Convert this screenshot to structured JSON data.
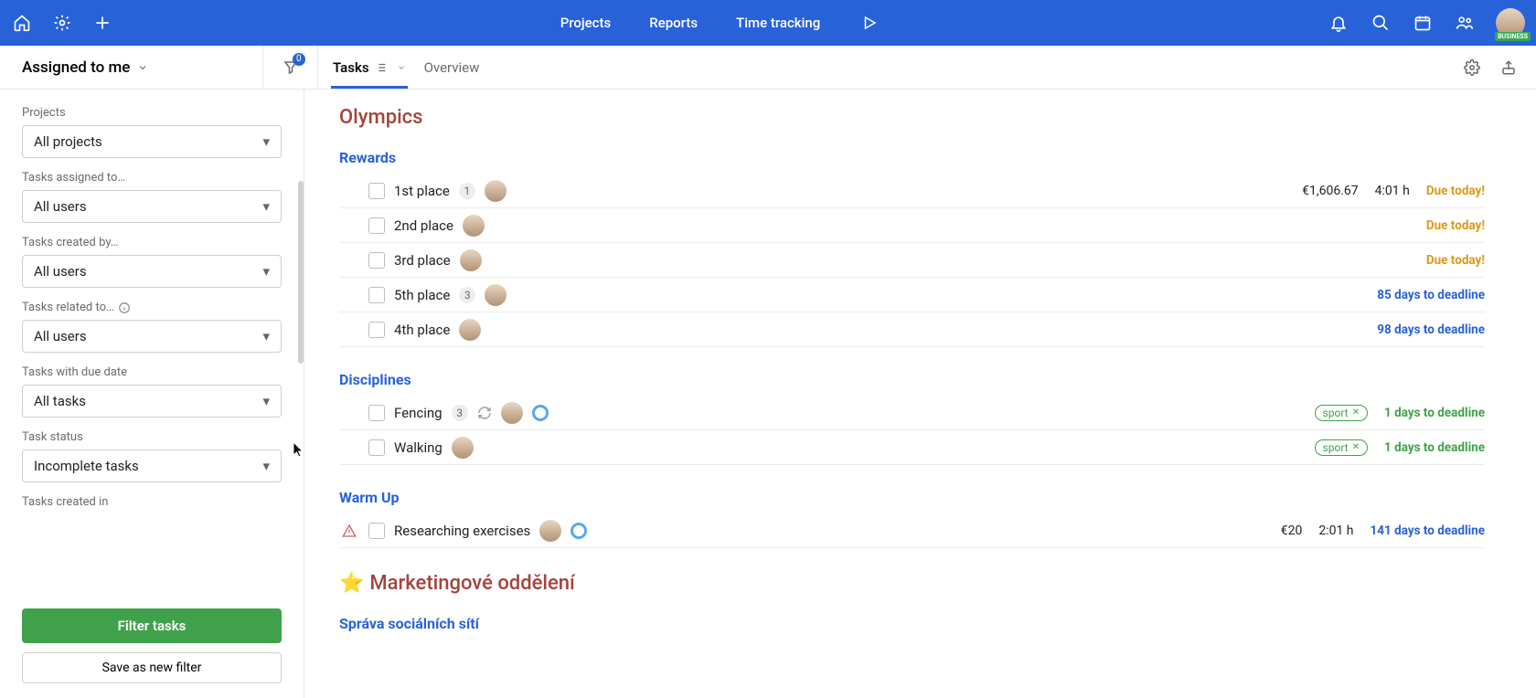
{
  "topnav": {
    "projects": "Projects",
    "reports": "Reports",
    "time_tracking": "Time tracking"
  },
  "avatar_badge": "BUSINESS",
  "sidebar_header": "Assigned to me",
  "filter_count": "0",
  "tabs": {
    "tasks": "Tasks",
    "overview": "Overview"
  },
  "filters": {
    "projects_label": "Projects",
    "projects_value": "All projects",
    "assigned_label": "Tasks assigned to…",
    "assigned_value": "All users",
    "created_by_label": "Tasks created by…",
    "created_by_value": "All users",
    "related_label": "Tasks related to…",
    "related_value": "All users",
    "due_label": "Tasks with due date",
    "due_value": "All tasks",
    "status_label": "Task status",
    "status_value": "Incomplete tasks",
    "created_in_label": "Tasks created in",
    "filter_btn": "Filter tasks",
    "save_btn": "Save as new filter"
  },
  "project1": {
    "title": "Olympics",
    "rewards_heading": "Rewards",
    "rewards": [
      {
        "name": "1st place",
        "badge": "1",
        "money": "€1,606.67",
        "hours": "4:01 h",
        "due": "Due today!",
        "due_type": "today"
      },
      {
        "name": "2nd place",
        "badge": "",
        "money": "",
        "hours": "",
        "due": "Due today!",
        "due_type": "today"
      },
      {
        "name": "3rd place",
        "badge": "",
        "money": "",
        "hours": "",
        "due": "Due today!",
        "due_type": "today"
      },
      {
        "name": "5th place",
        "badge": "3",
        "money": "",
        "hours": "",
        "due": "85 days to deadline",
        "due_type": "deadline"
      },
      {
        "name": "4th place",
        "badge": "",
        "money": "",
        "hours": "",
        "due": "98 days to deadline",
        "due_type": "deadline"
      }
    ],
    "disciplines_heading": "Disciplines",
    "disciplines": [
      {
        "name": "Fencing",
        "badge": "3",
        "recur": true,
        "ring": true,
        "tag": "sport",
        "due": "1 days to deadline",
        "due_type": "green"
      },
      {
        "name": "Walking",
        "badge": "",
        "recur": false,
        "ring": false,
        "tag": "sport",
        "due": "1 days to deadline",
        "due_type": "green"
      }
    ],
    "warmup_heading": "Warm Up",
    "warmup": [
      {
        "name": "Researching exercises",
        "warn": true,
        "ring": true,
        "money": "€20",
        "hours": "2:01 h",
        "due": "141 days to deadline",
        "due_type": "deadline"
      }
    ]
  },
  "project2": {
    "star": "⭐",
    "title": "Marketingové oddělení",
    "heading1": "Správa sociálních sítí"
  }
}
